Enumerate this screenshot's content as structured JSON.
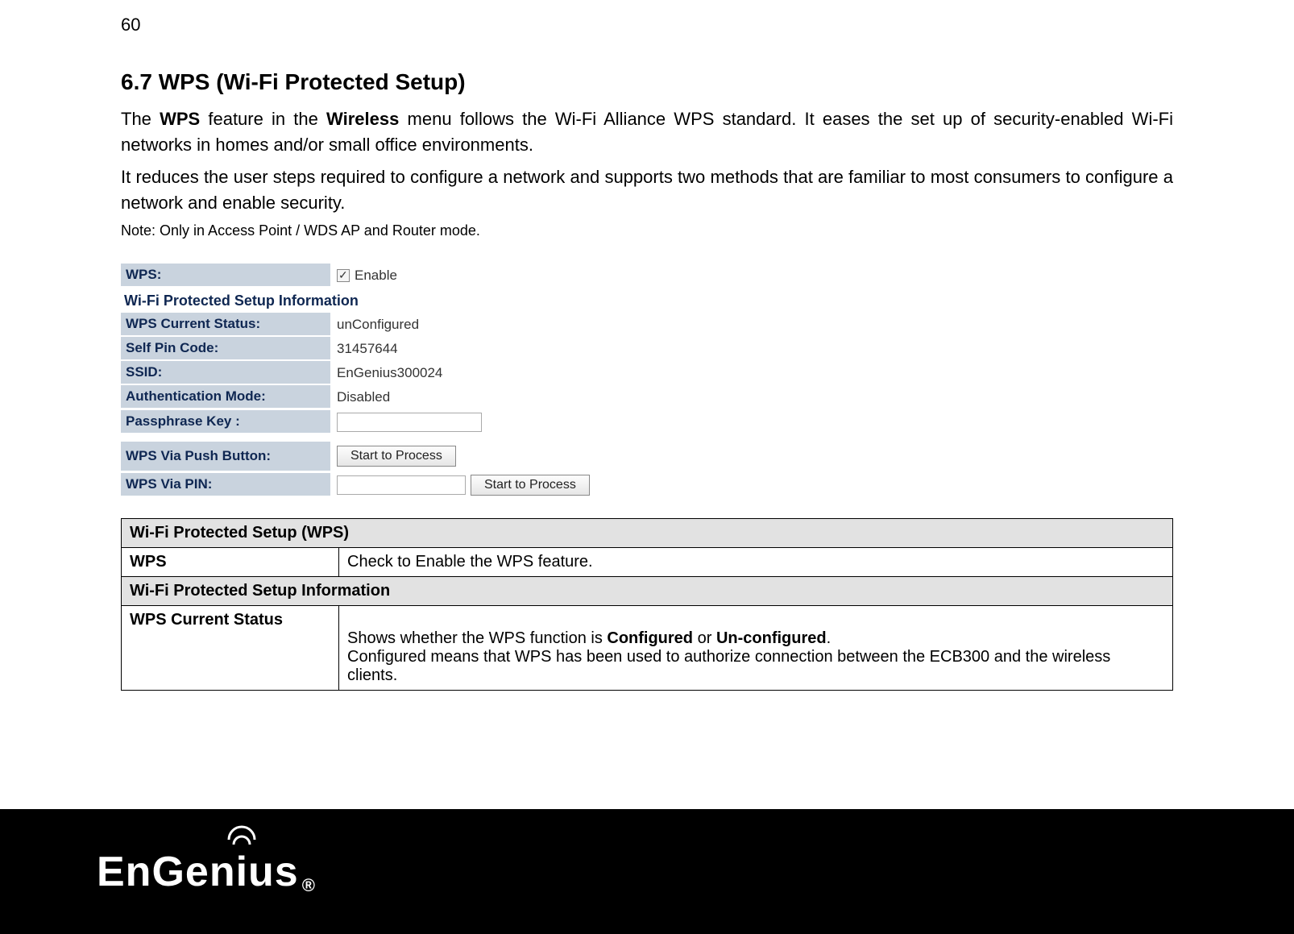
{
  "page_number": "60",
  "section_title": "6.7   WPS (Wi-Fi Protected Setup)",
  "para1_pre": "The ",
  "para1_b1": "WPS",
  "para1_mid": " feature in the ",
  "para1_b2": "Wireless",
  "para1_post": " menu follows the Wi-Fi Alliance WPS standard. It eases the set up of security-enabled Wi-Fi networks in homes and/or small office environments.",
  "para2": "It reduces the user steps required to configure a network and supports two methods that are familiar to most consumers to configure a network and enable security.",
  "note_label": "Note:",
  "note_text": " Only in Access Point / WDS AP and Router mode.",
  "ui": {
    "wps_label": "WPS:",
    "enable_label": "Enable",
    "section_header": "Wi-Fi Protected Setup Information",
    "status_label": "WPS Current Status:",
    "status_val": "unConfigured",
    "pin_label": "Self Pin Code:",
    "pin_val": "31457644",
    "ssid_label": "SSID:",
    "ssid_val": "EnGenius300024",
    "auth_label": "Authentication Mode:",
    "auth_val": "Disabled",
    "pass_label": "Passphrase Key :",
    "push_label": "WPS Via Push Button:",
    "push_btn": "Start to Process",
    "pinrow_label": "WPS Via PIN:",
    "pinrow_btn": "Start to Process"
  },
  "desc": {
    "h1": "Wi-Fi Protected Setup (WPS)",
    "r1c1": "WPS",
    "r1c2": "Check to Enable the WPS feature.",
    "h2": "Wi-Fi Protected Setup Information",
    "r2c1": "WPS Current Status",
    "r2c2_pre": "Shows whether the WPS function is ",
    "r2c2_b1": "Configured",
    "r2c2_mid": " or ",
    "r2c2_b2": "Un-configured",
    "r2c2_post": ".\nConfigured means that WPS has been used to authorize connection between the ECB300 and the wireless clients."
  },
  "logo": {
    "pre": "EnGen",
    "i": "i",
    "post": "us",
    "reg": "®"
  }
}
